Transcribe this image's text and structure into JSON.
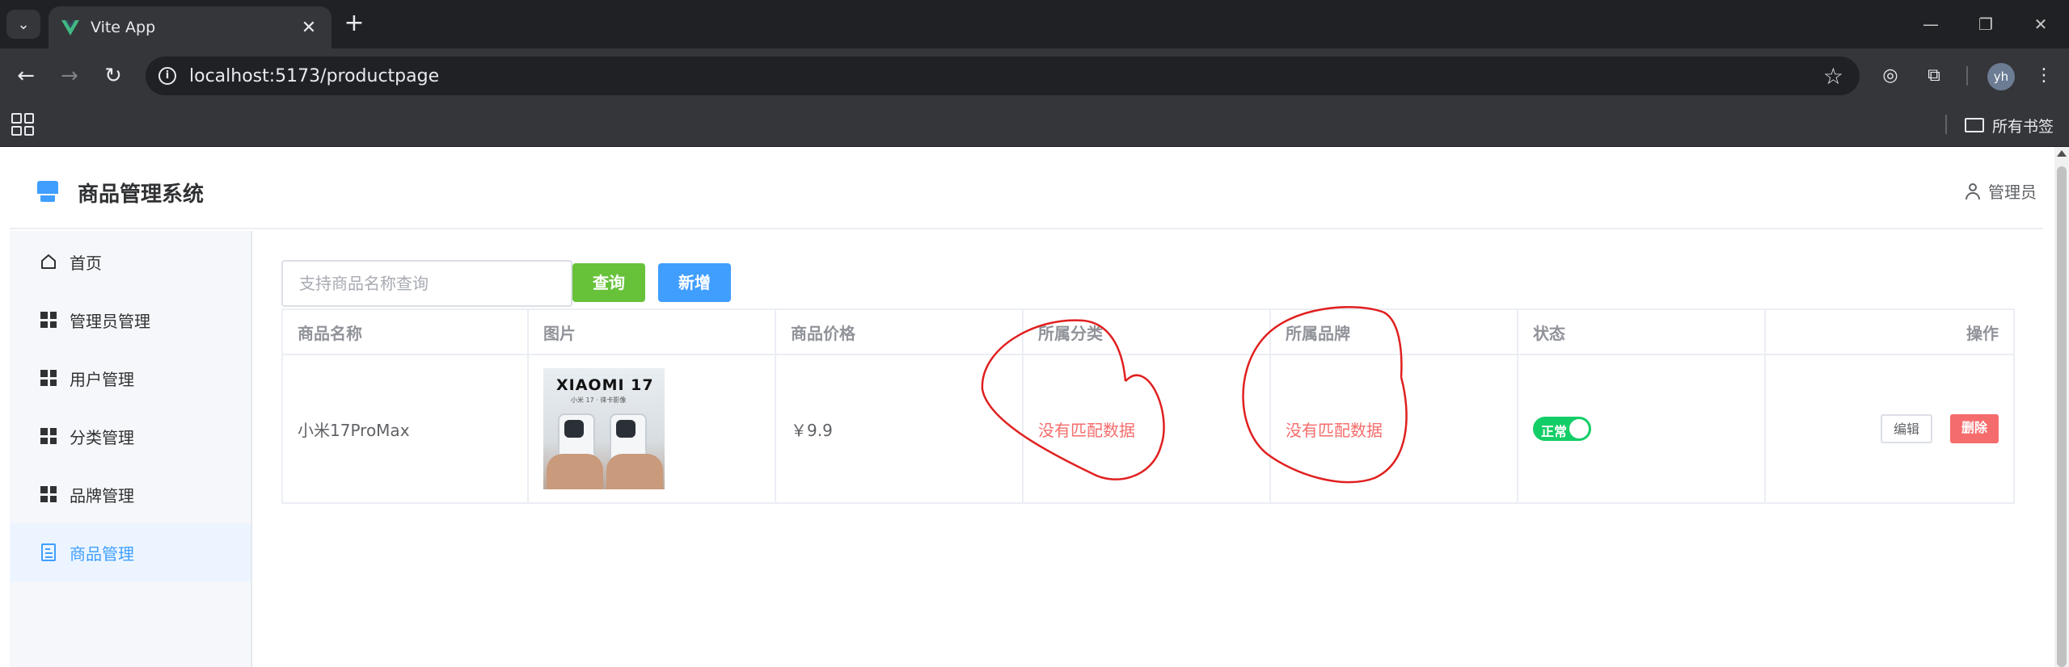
{
  "browser": {
    "tab_title": "Vite App",
    "tab_close": "✕",
    "new_tab": "+",
    "url": "localhost:5173/productpage",
    "avatar_initials": "yh",
    "bookmark_folder": "所有书签",
    "window_controls": [
      "—",
      "❐",
      "✕"
    ]
  },
  "app": {
    "title": "商品管理系统",
    "user": "管理员",
    "accent_color": "#409eff"
  },
  "sidebar": {
    "items": [
      {
        "label": "首页",
        "icon": "home-icon"
      },
      {
        "label": "管理员管理",
        "icon": "grid-icon"
      },
      {
        "label": "用户管理",
        "icon": "grid-icon"
      },
      {
        "label": "分类管理",
        "icon": "grid-icon"
      },
      {
        "label": "品牌管理",
        "icon": "grid-icon"
      },
      {
        "label": "商品管理",
        "icon": "document-icon",
        "active": true
      }
    ]
  },
  "toolbar": {
    "search_placeholder": "支持商品名称查询",
    "query_label": "查询",
    "add_label": "新增"
  },
  "table": {
    "headers": [
      "商品名称",
      "图片",
      "商品价格",
      "所属分类",
      "所属品牌",
      "状态",
      "操作"
    ],
    "rows": [
      {
        "name": "小米17ProMax",
        "image_brand": "XIAOMI 17",
        "image_sub": "小米 17 · 徕卡影像",
        "price": "￥9.9",
        "category": "没有匹配数据",
        "brand": "没有匹配数据",
        "status": "正常",
        "status_on": true,
        "edit_label": "编辑",
        "delete_label": "删除"
      }
    ]
  }
}
